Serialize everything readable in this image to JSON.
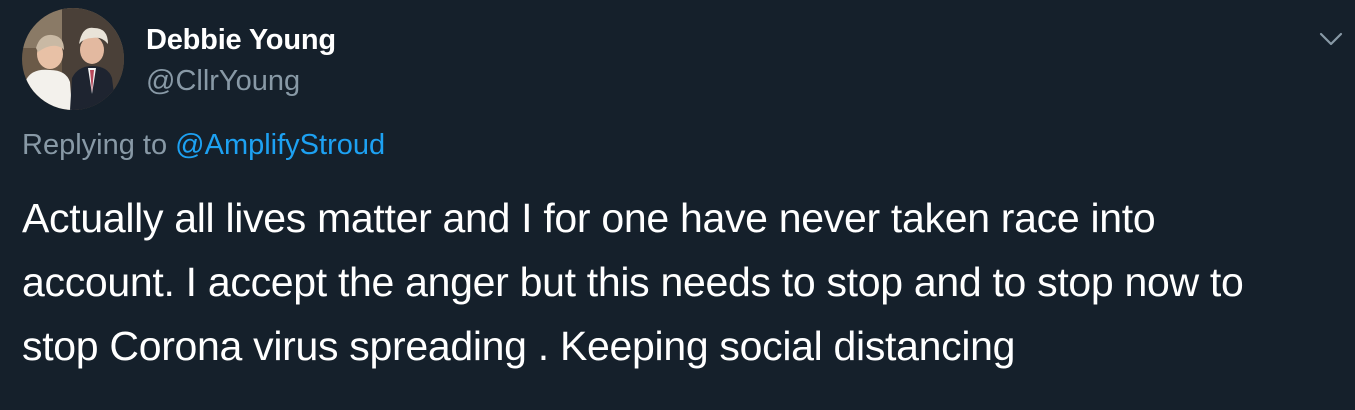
{
  "author": {
    "display_name": "Debbie Young",
    "handle": "@CllrYoung"
  },
  "reply": {
    "prefix": "Replying to ",
    "target": "@AmplifyStroud"
  },
  "tweet": {
    "line1": "Actually all lives matter and I for one have never taken race into",
    "line2": "account. I accept the anger but this needs to stop and to stop now to",
    "line3": "stop Corona virus spreading . Keeping social distancing"
  },
  "icons": {
    "avatar": "profile-photo",
    "menu": "chevron-down-icon"
  },
  "colors": {
    "background": "#15202b",
    "text_primary": "#ffffff",
    "text_secondary": "#8899a6",
    "link": "#1da1f2"
  }
}
